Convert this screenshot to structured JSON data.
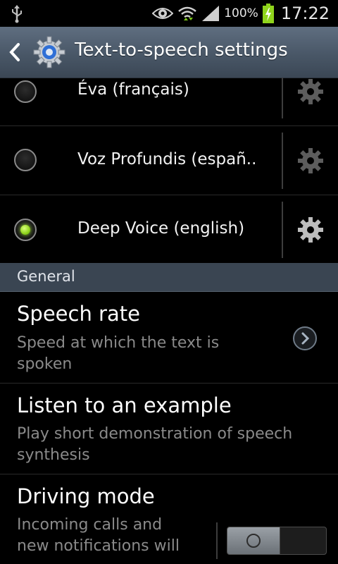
{
  "status_bar": {
    "usb_icon": "usb-icon",
    "eye_icon": "eye-icon",
    "wifi_icon": "wifi-icon",
    "signal_icon": "signal-icon",
    "battery_percent": "100%",
    "battery_icon": "battery-charging-icon",
    "time": "17:22"
  },
  "action_bar": {
    "title": "Text-to-speech settings",
    "back_icon": "chevron-left-icon",
    "app_icon": "settings-gear-icon"
  },
  "engines": [
    {
      "label": "Éva (français)",
      "selected": false
    },
    {
      "label": "Voz Profundis (españ..",
      "selected": false
    },
    {
      "label": "Deep Voice (english)",
      "selected": true
    }
  ],
  "section": {
    "label": "General"
  },
  "prefs": {
    "speech_rate": {
      "title": "Speech rate",
      "summary_line1": "Speed at which the text is",
      "summary_line2": "spoken"
    },
    "listen_example": {
      "title": "Listen to an example",
      "summary_line1": "Play short demonstration of speech",
      "summary_line2": "synthesis"
    },
    "driving_mode": {
      "title": "Driving mode",
      "summary_line1": "Incoming calls and",
      "summary_line2": "new notifications will",
      "toggle_on": false
    }
  },
  "colors": {
    "action_bar": "#4a5767",
    "section_header": "#3a4552",
    "radio_selected": "#8fd41c"
  }
}
